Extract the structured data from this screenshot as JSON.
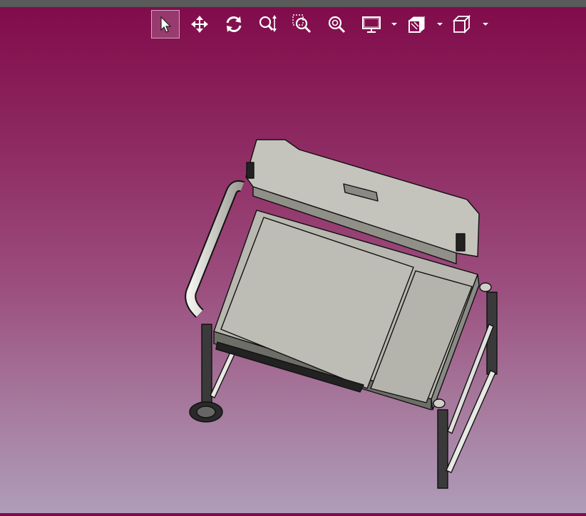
{
  "app": {
    "accent": "#800a4a",
    "viewport_gradient": [
      "#800a4a",
      "#ae9dba"
    ]
  },
  "toolbar": {
    "tools": [
      {
        "id": "select",
        "icon": "cursor-arrow-icon",
        "active": true
      },
      {
        "id": "pan",
        "icon": "move-arrows-icon",
        "active": false
      },
      {
        "id": "rotate",
        "icon": "rotate-icon",
        "active": false
      },
      {
        "id": "zoom",
        "icon": "zoom-updown-icon",
        "active": false
      },
      {
        "id": "zoom-window",
        "icon": "zoom-window-icon",
        "active": false
      },
      {
        "id": "zoom-fit",
        "icon": "zoom-fit-icon",
        "active": false
      },
      {
        "id": "display-mode",
        "icon": "monitor-icon",
        "has_dropdown": true
      },
      {
        "id": "section-view",
        "icon": "section-cube-icon",
        "has_dropdown": true
      },
      {
        "id": "view-orientation",
        "icon": "cube-icon",
        "has_dropdown": true
      }
    ]
  },
  "model": {
    "icon": "grill-cart-3d-model"
  }
}
